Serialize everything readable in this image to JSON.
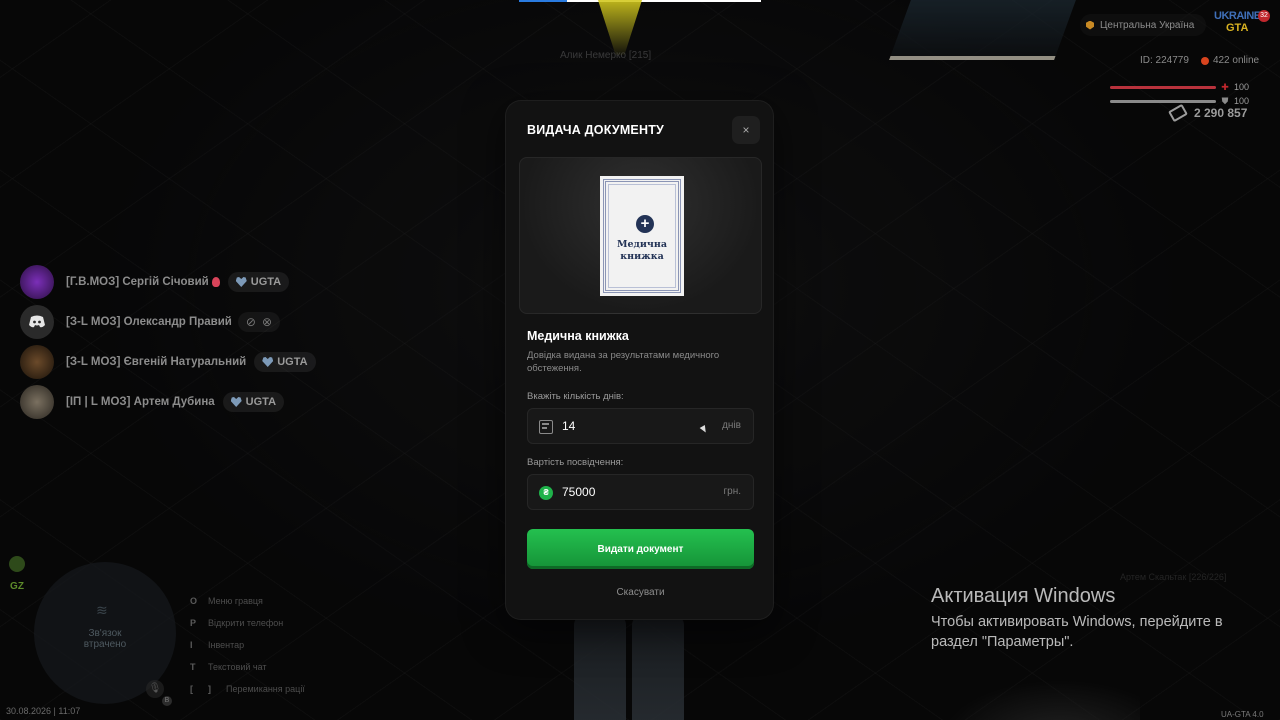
{
  "hud": {
    "region": "Центральна Україна",
    "logo_top": "UKRAINE",
    "logo_bottom": "GTA",
    "logo_badge": "32",
    "player_id": "ID: 224779",
    "online": "422 online",
    "health": "100",
    "armor": "100",
    "health_level": 1.0,
    "armor_level": 1.0,
    "money": "2 290 857",
    "top_progress": 0.2,
    "nearby_player": "Алик Немерко [215]",
    "nearby_player_right": "Артем Скальтак [226/226]"
  },
  "voice": [
    {
      "name": "[Г.В.МОЗ] Сергій Січовий",
      "tag": "UGTA",
      "avatar": "purple-demon-avatar"
    },
    {
      "name": "[З-L МОЗ] Олександр Правий",
      "tag": "",
      "avatar": "discord-avatar",
      "status": "muted"
    },
    {
      "name": "[З-L МОЗ] Євгеній Натуральний",
      "tag": "UGTA",
      "avatar": "character-avatar"
    },
    {
      "name": "[ІП | L МОЗ] Артем Дубина",
      "tag": "UGTA",
      "avatar": "cat-avatar"
    }
  ],
  "bottom_left": {
    "gz_label": "GZ",
    "radar_text_1": "Зв'язок",
    "radar_text_2": "втрачено",
    "mic_badge": "B",
    "hotkeys": [
      {
        "key": "O",
        "label": "Меню гравця"
      },
      {
        "key": "P",
        "label": "Відкрити телефон"
      },
      {
        "key": "I",
        "label": "Інвентар"
      },
      {
        "key": "T",
        "label": "Текстовий чат"
      },
      {
        "key": "[",
        "key2": "]",
        "label": "Перемикання рації"
      }
    ],
    "datetime": "30.08.2026 | 11:07"
  },
  "version": "UA-GTA 4.0",
  "windows": {
    "title": "Активация Windows",
    "text": "Чтобы активировать Windows, перейдите в раздел \"Параметры\"."
  },
  "modal": {
    "title": "ВИДАЧА ДОКУМЕНТУ",
    "close": "×",
    "doc_line1": "Медична",
    "doc_line2": "книжка",
    "doc_name": "Медична книжка",
    "doc_desc": "Довідка видана за результатами медичного обстеження.",
    "days_label": "Вкажіть кількість днів:",
    "days_value": "14",
    "days_unit": "днів",
    "price_label": "Вартість посвідчення:",
    "price_value": "75000",
    "price_unit": "грн.",
    "coin_symbol": "₴",
    "submit": "Видати документ",
    "cancel": "Скасувати"
  },
  "colors": {
    "accent_green": "#1fb24a",
    "health_red": "#c0272d",
    "doc_navy": "#233356"
  }
}
